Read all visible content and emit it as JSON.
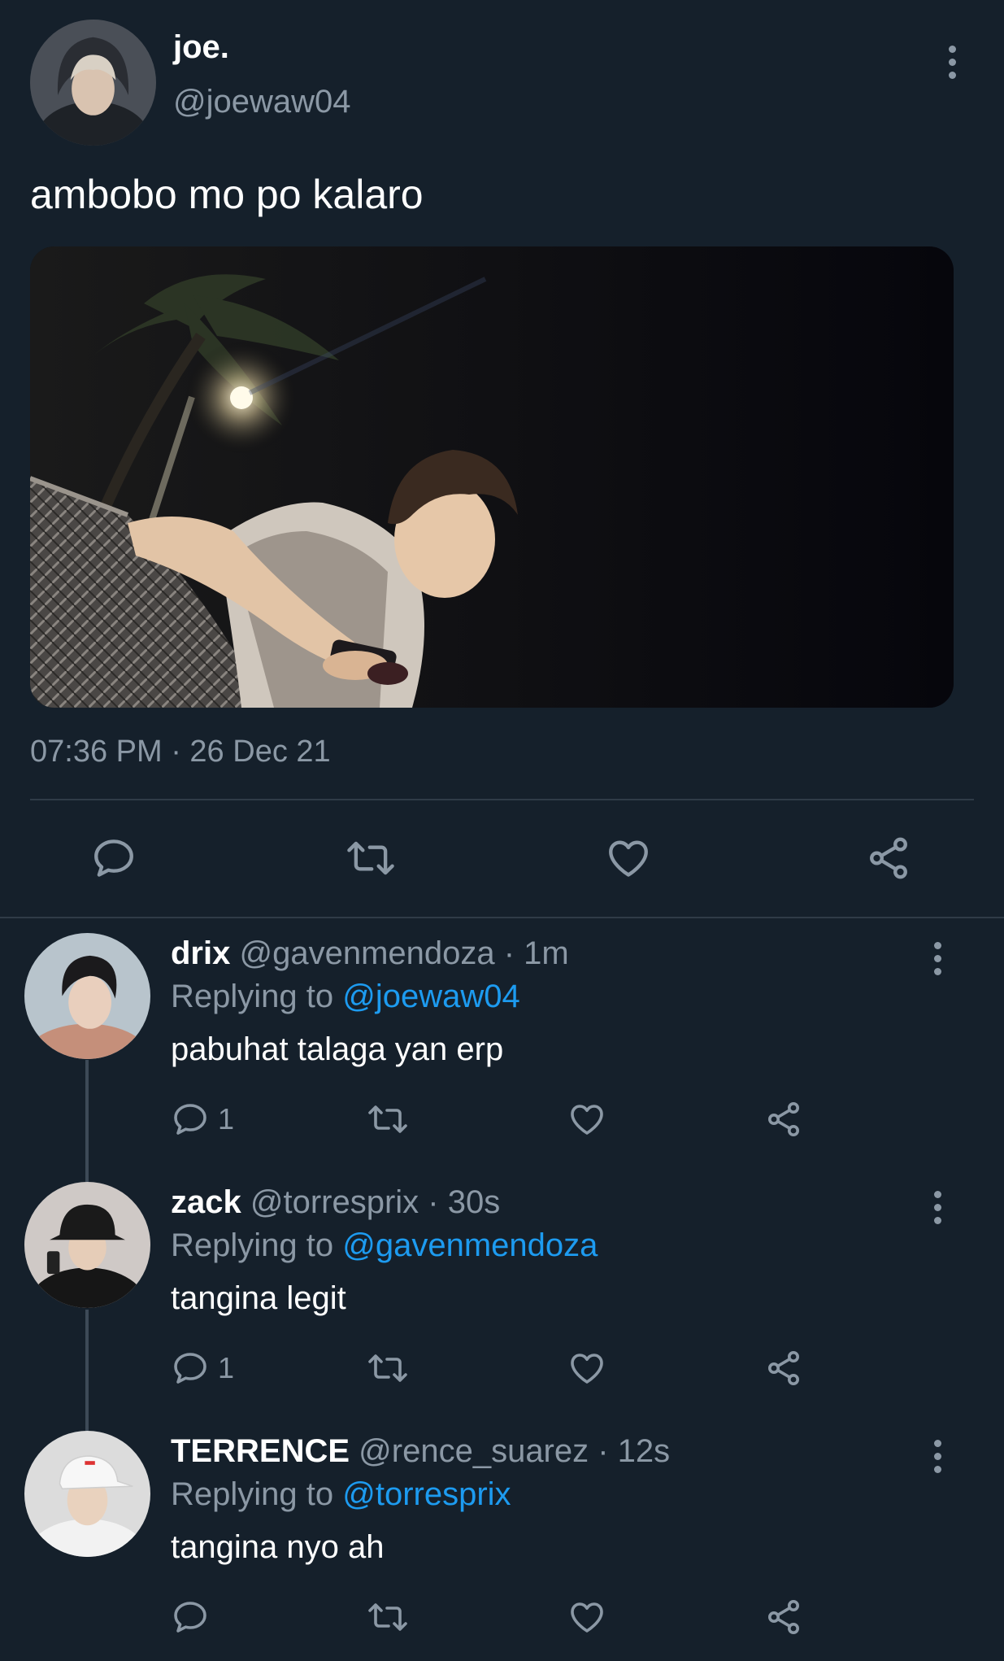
{
  "main_tweet": {
    "display_name": "joe.",
    "handle": "@joewaw04",
    "text": "ambobo mo po kalaro",
    "timestamp": "07:36 PM · 26 Dec 21",
    "image_alt": "photo",
    "actions": [
      "reply-icon",
      "retweet-icon",
      "like-icon",
      "share-icon"
    ]
  },
  "replies": [
    {
      "display_name": "drix",
      "meta": "@gavenmendoza · 1m",
      "replying_prefix": "Replying to",
      "replying_to": "@joewaw04",
      "text": "pabuhat talaga yan erp",
      "reply_count": "1"
    },
    {
      "display_name": "zack",
      "meta": "@torresprix · 30s",
      "replying_prefix": "Replying to",
      "replying_to": "@gavenmendoza",
      "text": "tangina legit",
      "reply_count": "1"
    },
    {
      "display_name": "TERRENCE",
      "meta": "@rence_suarez · 12s",
      "replying_prefix": "Replying to",
      "replying_to": "@torresprix",
      "text": "tangina nyo ah",
      "reply_count": ""
    }
  ],
  "colors": {
    "background": "#15202b",
    "text": "#ffffff",
    "muted": "#8b98a5",
    "link": "#1d9bf0",
    "divider": "#2f3b47"
  }
}
